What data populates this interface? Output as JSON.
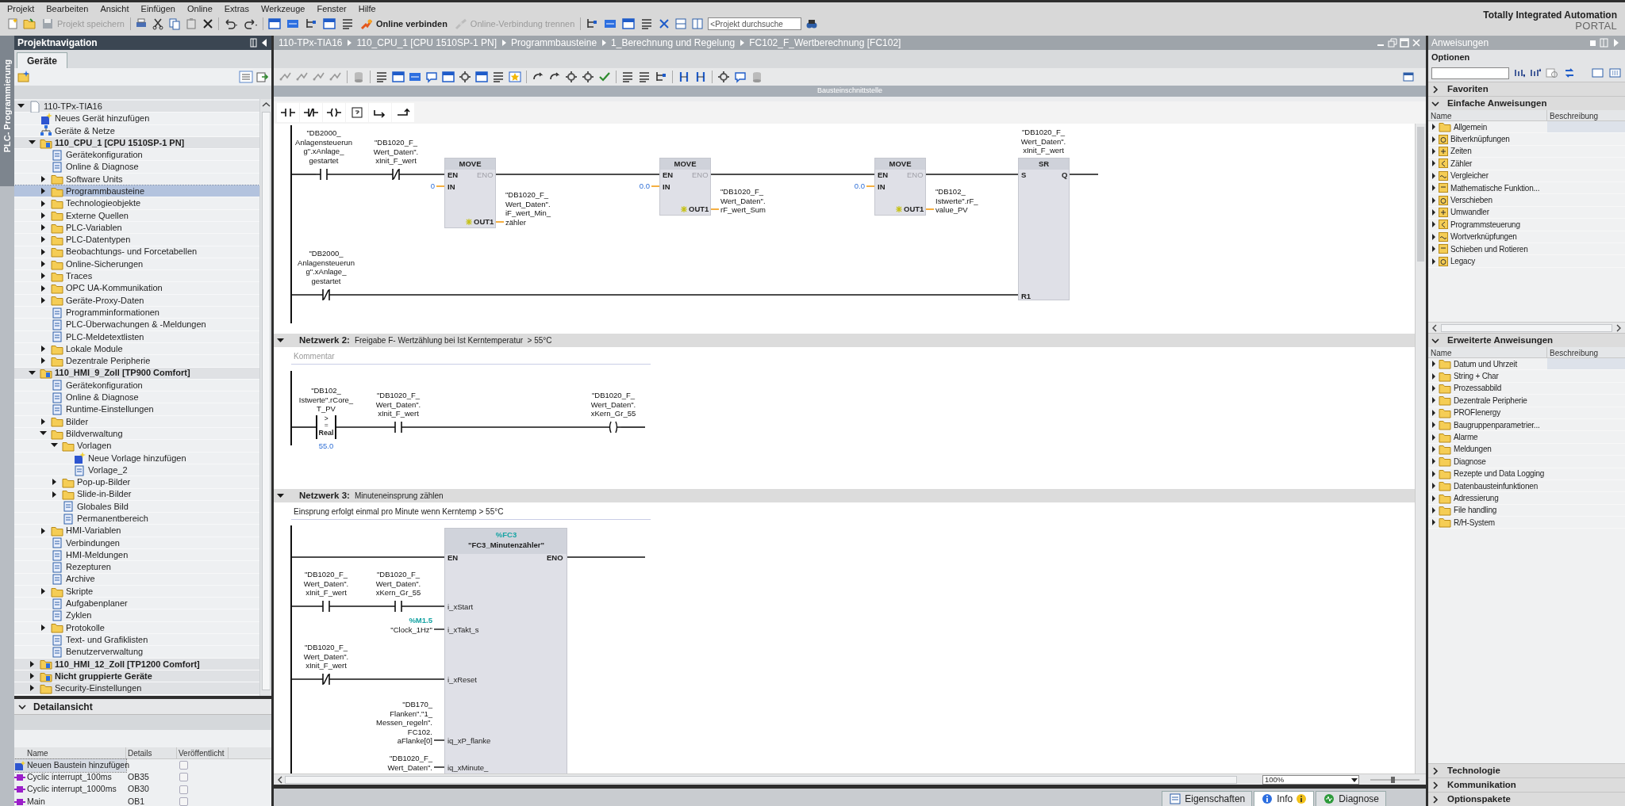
{
  "menu": [
    "Projekt",
    "Bearbeiten",
    "Ansicht",
    "Einfügen",
    "Online",
    "Extras",
    "Werkzeuge",
    "Fenster",
    "Hilfe"
  ],
  "toolbar": [
    {
      "kind": "save",
      "label": "Projekt speichern",
      "disabled": true
    },
    {
      "kind": "connect",
      "label": "Online verbinden",
      "disabled": false
    },
    {
      "kind": "disconnect",
      "label": "Online-Verbindung trennen",
      "disabled": true
    }
  ],
  "search": {
    "placeholder": "<Projekt durchsuche"
  },
  "brand": {
    "line1": "Totally Integrated Automation",
    "line2": "PORTAL"
  },
  "side_tab": "PLC- Programmierung",
  "project_nav": {
    "title": "Projektnavigation",
    "tabs": [
      {
        "label": "Geräte",
        "selected": true
      }
    ],
    "tree": [
      {
        "label": "110-TPx-TIA16",
        "kind": "project",
        "expanded": true,
        "selected": false,
        "children": [
          {
            "label": "Neues Gerät hinzufügen",
            "kind": "add",
            "selected": false
          },
          {
            "label": "Geräte & Netze",
            "kind": "network",
            "selected": false
          },
          {
            "label": "110_CPU_1 [CPU 1510SP-1 PN]",
            "kind": "device",
            "expanded": true,
            "selected": false,
            "children": [
              {
                "label": "Gerätekonfiguration",
                "kind": "item",
                "selected": false
              },
              {
                "label": "Online & Diagnose",
                "kind": "item",
                "selected": false
              },
              {
                "label": "Software Units",
                "kind": "folder",
                "expanded": false,
                "selected": false
              },
              {
                "label": "Programmbausteine",
                "kind": "folder",
                "expanded": false,
                "selected": true
              },
              {
                "label": "Technologieobjekte",
                "kind": "folder",
                "expanded": false,
                "selected": false
              },
              {
                "label": "Externe Quellen",
                "kind": "folder",
                "expanded": false,
                "selected": false
              },
              {
                "label": "PLC-Variablen",
                "kind": "folder",
                "expanded": false,
                "selected": false
              },
              {
                "label": "PLC-Datentypen",
                "kind": "folder",
                "expanded": false,
                "selected": false
              },
              {
                "label": "Beobachtungs- und Forcetabellen",
                "kind": "folder",
                "expanded": false,
                "selected": false
              },
              {
                "label": "Online-Sicherungen",
                "kind": "folder",
                "expanded": false,
                "selected": false
              },
              {
                "label": "Traces",
                "kind": "folder",
                "expanded": false,
                "selected": false
              },
              {
                "label": "OPC UA-Kommunikation",
                "kind": "folder",
                "expanded": false,
                "selected": false
              },
              {
                "label": "Geräte-Proxy-Daten",
                "kind": "folder",
                "expanded": false,
                "selected": false
              },
              {
                "label": "Programminformationen",
                "kind": "item",
                "selected": false
              },
              {
                "label": "PLC-Überwachungen & -Meldungen",
                "kind": "item",
                "selected": false
              },
              {
                "label": "PLC-Meldetextlisten",
                "kind": "item",
                "selected": false
              },
              {
                "label": "Lokale Module",
                "kind": "folder",
                "expanded": false,
                "selected": false
              },
              {
                "label": "Dezentrale Peripherie",
                "kind": "folder",
                "expanded": false,
                "selected": false
              }
            ]
          },
          {
            "label": "110_HMI_9_Zoll [TP900 Comfort]",
            "kind": "device",
            "expanded": true,
            "selected": false,
            "children": [
              {
                "label": "Gerätekonfiguration",
                "kind": "item",
                "selected": false
              },
              {
                "label": "Online & Diagnose",
                "kind": "item",
                "selected": false
              },
              {
                "label": "Runtime-Einstellungen",
                "kind": "item",
                "selected": false
              },
              {
                "label": "Bilder",
                "kind": "folder",
                "expanded": false,
                "selected": false
              },
              {
                "label": "Bildverwaltung",
                "kind": "folder",
                "expanded": true,
                "selected": false,
                "children": [
                  {
                    "label": "Vorlagen",
                    "kind": "folder",
                    "expanded": true,
                    "selected": false,
                    "children": [
                      {
                        "label": "Neue Vorlage hinzufügen",
                        "kind": "add",
                        "selected": false
                      },
                      {
                        "label": "Vorlage_2",
                        "kind": "item",
                        "selected": false
                      }
                    ]
                  },
                  {
                    "label": "Pop-up-Bilder",
                    "kind": "folder",
                    "expanded": false,
                    "selected": false
                  },
                  {
                    "label": "Slide-in-Bilder",
                    "kind": "folder",
                    "expanded": false,
                    "selected": false
                  },
                  {
                    "label": "Globales Bild",
                    "kind": "item",
                    "selected": false
                  },
                  {
                    "label": "Permanentbereich",
                    "kind": "item",
                    "selected": false
                  }
                ]
              },
              {
                "label": "HMI-Variablen",
                "kind": "folder",
                "expanded": false,
                "selected": false
              },
              {
                "label": "Verbindungen",
                "kind": "item",
                "selected": false
              },
              {
                "label": "HMI-Meldungen",
                "kind": "item",
                "selected": false
              },
              {
                "label": "Rezepturen",
                "kind": "item",
                "selected": false
              },
              {
                "label": "Archive",
                "kind": "item",
                "selected": false
              },
              {
                "label": "Skripte",
                "kind": "folder",
                "expanded": false,
                "selected": false
              },
              {
                "label": "Aufgabenplaner",
                "kind": "item",
                "selected": false
              },
              {
                "label": "Zyklen",
                "kind": "item",
                "selected": false
              },
              {
                "label": "Protokolle",
                "kind": "folder",
                "expanded": false,
                "selected": false
              },
              {
                "label": "Text- und Grafiklisten",
                "kind": "item",
                "selected": false
              },
              {
                "label": "Benutzerverwaltung",
                "kind": "item",
                "selected": false
              }
            ]
          },
          {
            "label": "110_HMI_12_Zoll [TP1200 Comfort]",
            "kind": "device",
            "expanded": false,
            "selected": false
          },
          {
            "label": "Nicht gruppierte Geräte",
            "kind": "device",
            "expanded": false,
            "selected": false
          },
          {
            "label": "Security-Einstellungen",
            "kind": "folder",
            "expanded": false,
            "selected": false
          }
        ]
      }
    ]
  },
  "detail_view": {
    "title": "Detailansicht",
    "columns": [
      "Name",
      "Details",
      "Veröffentlicht"
    ],
    "rows": [
      {
        "kind": "add",
        "name": "Neuen Baustein hinzufügen",
        "checked": false,
        "selected": true
      },
      {
        "kind": "block",
        "name": "Cyclic interrupt_100ms",
        "details": "OB35",
        "checked": false,
        "selected": false
      },
      {
        "kind": "block",
        "name": "Cyclic interrupt_1000ms",
        "details": "OB30",
        "checked": false,
        "selected": false
      },
      {
        "kind": "block",
        "name": "Main",
        "details": "OB1",
        "checked": false,
        "selected": false
      }
    ]
  },
  "editor": {
    "breadcrumb": [
      "110-TPx-TIA16",
      "110_CPU_1 [CPU 1510SP-1 PN]",
      "Programmbausteine",
      "1_Berechnung und Regelung",
      "FC102_F_Wertberechnung [FC102]"
    ],
    "interface_bar": "Bausteinschnittstelle",
    "networks": [
      {
        "elements": [
          {
            "kind": "contact_no",
            "operand": "\"DB2000_\nAnlagensteuerun\ng\".xAnlage_\ngestartet"
          },
          {
            "kind": "contact_nc",
            "operand": "\"DB1020_F_\nWert_Daten\".\nxInit_F_wert"
          },
          {
            "kind": "move",
            "title": "MOVE",
            "en": "EN",
            "eno": "ENO",
            "in_pin": "IN",
            "in_value": "0",
            "out_pin": "OUT1",
            "out_operand": "\"DB1020_F_\nWert_Daten\".\niF_wert_Min_\nzähler"
          },
          {
            "kind": "move",
            "title": "MOVE",
            "en": "EN",
            "eno": "ENO",
            "in_pin": "IN",
            "in_value": "0.0",
            "out_pin": "OUT1",
            "out_operand": "\"DB1020_F_\nWert_Daten\".\nrF_wert_Sum"
          },
          {
            "kind": "move",
            "title": "MOVE",
            "en": "EN",
            "eno": "ENO",
            "in_pin": "IN",
            "in_value": "0.0",
            "out_pin": "OUT1",
            "out_operand": "\"DB102_\nIstwerte\".rF_\nvalue_PV"
          },
          {
            "kind": "sr",
            "title": "SR",
            "operand": "\"DB1020_F_\nWert_Daten\".\nxInit_F_wert",
            "s_pin": "S",
            "q_pin": "Q",
            "r_pin": "R1"
          },
          {
            "kind": "contact_nc",
            "operand": "\"DB2000_\nAnlagensteuerun\ng\".xAnlage_\ngestartet"
          }
        ]
      },
      {
        "title": "Netzwerk 2:",
        "description": "Freigabe F- Wertzählung bei Ist Kerntemperatur  > 55°C",
        "expanded": true,
        "comment_placeholder": "Kommentar",
        "elements": [
          {
            "kind": "compare",
            "operand": "\"DB102_\nIstwerte\".rCore_\nT_PV",
            "op": ">=",
            "type": "Real",
            "value": "55.0"
          },
          {
            "kind": "contact_no",
            "operand": "\"DB1020_F_\nWert_Daten\".\nxInit_F_wert"
          },
          {
            "kind": "coil",
            "operand": "\"DB1020_F_\nWert_Daten\".\nxKern_Gr_55"
          }
        ]
      },
      {
        "title": "Netzwerk 3:",
        "description": "Minuteneinsprung zählen",
        "expanded": true,
        "comment": "Einsprung erfolgt einmal pro Minute wenn Kerntemp > 55°C",
        "elements": [
          {
            "kind": "call",
            "address": "%FC3",
            "title": "\"FC3_Minutenzähler\"",
            "en": "EN",
            "eno": "ENO",
            "params": [
              {
                "pin": "i_xStart"
              },
              {
                "pin": "i_xTakt_s",
                "address": "%M1.5",
                "operand": "\"Clock_1Hz\""
              },
              {
                "pin": "i_xReset"
              },
              {
                "pin": "iq_xP_flanke",
                "operand": "\"DB170_\nFlanken\".\"1_\nMessen_regeln\".\nFC102.\naFlanke[0]"
              },
              {
                "pin": "iq_xMinute_",
                "operand": "\"DB1020_F_\nWert_Daten\"."
              }
            ]
          },
          {
            "kind": "contact_no",
            "operand": "\"DB1020_F_\nWert_Daten\".\nxInit_F_wert"
          },
          {
            "kind": "contact_no",
            "operand": "\"DB1020_F_\nWert_Daten\".\nxKern_Gr_55"
          },
          {
            "kind": "contact_nc",
            "operand": "\"DB1020_F_\nWert_Daten\".\nxInit_F_wert"
          }
        ]
      }
    ],
    "zoom": "100%"
  },
  "instructions": {
    "title": "Anweisungen",
    "options_label": "Optionen",
    "sections": [
      {
        "title": "Favoriten",
        "expanded": false
      },
      {
        "title": "Einfache Anweisungen",
        "expanded": true,
        "columns": [
          "Name",
          "Beschreibung"
        ],
        "items": [
          {
            "label": "Allgemein",
            "kind": "folder",
            "selected": true
          },
          {
            "label": "Bitverknüpfungen",
            "kind": "group",
            "selected": false
          },
          {
            "label": "Zeiten",
            "kind": "group",
            "selected": false
          },
          {
            "label": "Zähler",
            "kind": "group",
            "selected": false
          },
          {
            "label": "Vergleicher",
            "kind": "group",
            "selected": false
          },
          {
            "label": "Mathematische Funktion...",
            "kind": "group",
            "selected": false
          },
          {
            "label": "Verschieben",
            "kind": "group",
            "selected": false
          },
          {
            "label": "Umwandler",
            "kind": "group",
            "selected": false
          },
          {
            "label": "Programmsteuerung",
            "kind": "group",
            "selected": false
          },
          {
            "label": "Wortverknüpfungen",
            "kind": "group",
            "selected": false
          },
          {
            "label": "Schieben und Rotieren",
            "kind": "group",
            "selected": false
          },
          {
            "label": "Legacy",
            "kind": "group",
            "selected": false
          }
        ]
      },
      {
        "title": "Erweiterte Anweisungen",
        "expanded": true,
        "columns": [
          "Name",
          "Beschreibung"
        ],
        "items": [
          {
            "label": "Datum und Uhrzeit",
            "kind": "folder",
            "selected": true
          },
          {
            "label": "String + Char",
            "kind": "folder",
            "selected": false
          },
          {
            "label": "Prozessabbild",
            "kind": "folder",
            "selected": false
          },
          {
            "label": "Dezentrale Peripherie",
            "kind": "folder",
            "selected": false
          },
          {
            "label": "PROFIenergy",
            "kind": "folder",
            "selected": false
          },
          {
            "label": "Baugruppenparametrier...",
            "kind": "folder",
            "selected": false
          },
          {
            "label": "Alarme",
            "kind": "folder",
            "selected": false
          },
          {
            "label": "Meldungen",
            "kind": "folder",
            "selected": false
          },
          {
            "label": "Diagnose",
            "kind": "folder",
            "selected": false
          },
          {
            "label": "Rezepte und Data Logging",
            "kind": "folder",
            "selected": false
          },
          {
            "label": "Datenbausteinfunktionen",
            "kind": "folder",
            "selected": false
          },
          {
            "label": "Adressierung",
            "kind": "folder",
            "selected": false
          },
          {
            "label": "File handling",
            "kind": "folder",
            "selected": false
          },
          {
            "label": "R/H-System",
            "kind": "folder",
            "selected": false
          }
        ]
      },
      {
        "title": "Technologie",
        "expanded": false
      },
      {
        "title": "Kommunikation",
        "expanded": false
      },
      {
        "title": "Optionspakete",
        "expanded": false
      }
    ]
  },
  "bottom_tabs": [
    {
      "kind": "properties",
      "label": "Eigenschaften",
      "selected": false
    },
    {
      "kind": "info",
      "label": "Info",
      "selected": true
    },
    {
      "kind": "diagnostics",
      "label": "Diagnose",
      "selected": false
    }
  ]
}
